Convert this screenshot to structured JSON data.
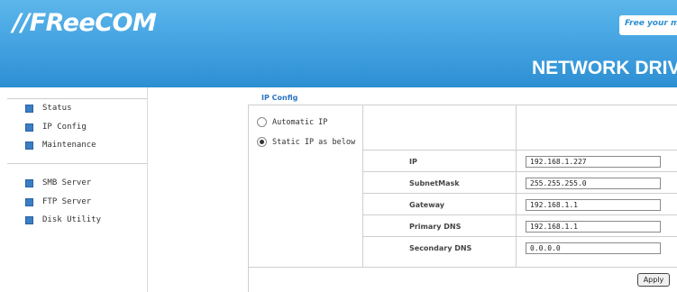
{
  "header": {
    "logo_text": "//FReeCOM",
    "tagline": "Free your mind",
    "product_title": "NETWORK DRIVE"
  },
  "sidebar": {
    "items": [
      {
        "label": "Status",
        "icon": "square-bullet-icon"
      },
      {
        "label": "IP Config",
        "icon": "square-bullet-icon"
      },
      {
        "label": "Maintenance",
        "icon": "square-bullet-icon"
      },
      {
        "label": "SMB Server",
        "icon": "square-bullet-icon"
      },
      {
        "label": "FTP Server",
        "icon": "square-bullet-icon"
      },
      {
        "label": "Disk Utility",
        "icon": "square-bullet-icon"
      }
    ]
  },
  "ip_config": {
    "title": "IP Config",
    "mode_options": [
      "Automatic IP",
      "Static IP as below"
    ],
    "selected_mode": "Static IP as below",
    "fields": [
      {
        "label": "IP",
        "value": "192.168.1.227"
      },
      {
        "label": "SubnetMask",
        "value": "255.255.255.0"
      },
      {
        "label": "Gateway",
        "value": "192.168.1.1"
      },
      {
        "label": "Primary DNS",
        "value": "192.168.1.1"
      },
      {
        "label": "Secondary DNS",
        "value": "0.0.0.0"
      }
    ],
    "apply_label": "Apply"
  },
  "colors": {
    "header_blue": "#3f9fdf",
    "accent_blue": "#2c74c4",
    "bullet_blue": "#3a7ec4"
  }
}
